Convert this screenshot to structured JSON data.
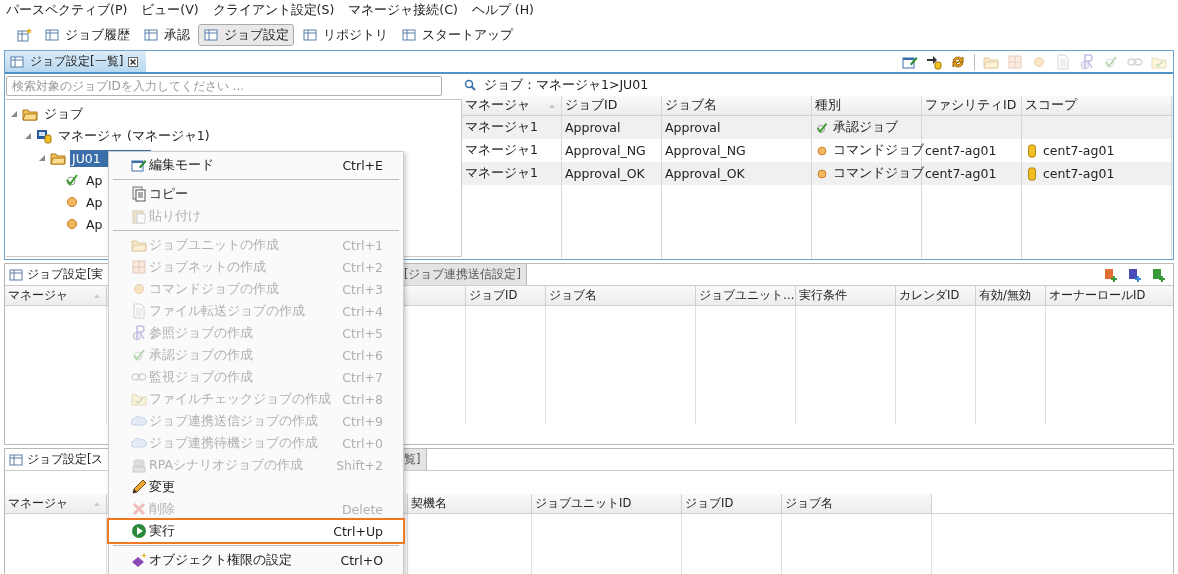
{
  "menu_bar": [
    "パースペクティブ(P)",
    "ビュー(V)",
    "クライアント設定(S)",
    "マネージャ接続(C)",
    "ヘルプ (H)"
  ],
  "perspectives": [
    {
      "label": "ジョブ履歴",
      "selected": false
    },
    {
      "label": "承認",
      "selected": false
    },
    {
      "label": "ジョブ設定",
      "selected": true
    },
    {
      "label": "リポジトリ",
      "selected": false
    },
    {
      "label": "スタートアップ",
      "selected": false
    }
  ],
  "job_list_view": {
    "tab": "ジョブ設定[一覧]",
    "search": {
      "placeholder": "検索対象のジョブIDを入力してください ..."
    },
    "tree": [
      {
        "label": "ジョブ",
        "kind": "root",
        "expanded": true,
        "selected": false,
        "children": [
          {
            "label": "マネージャ (マネージャ1)",
            "kind": "manager",
            "expanded": true,
            "selected": false,
            "children": [
              {
                "label": "JU01",
                "kind": "jobunit",
                "expanded": true,
                "selected": true,
                "children": [
                  {
                    "label": "Ap",
                    "kind": "approval",
                    "selected": false
                  },
                  {
                    "label": "Ap",
                    "kind": "command",
                    "selected": false
                  },
                  {
                    "label": "Ap",
                    "kind": "command",
                    "selected": false
                  }
                ]
              }
            ]
          }
        ]
      }
    ],
    "breadcrumb": "ジョブ：マネージャ1>JU01",
    "table": {
      "columns": [
        "マネージャ",
        "ジョブID",
        "ジョブ名",
        "種別",
        "ファシリティID",
        "スコープ"
      ],
      "rows": [
        {
          "manager": "マネージャ1",
          "job_id": "Approval",
          "job_name": "Approval",
          "kind": "approval",
          "type": "承認ジョブ"
        },
        {
          "manager": "マネージャ1",
          "job_id": "Approval_NG",
          "job_name": "Approval_NG",
          "kind": "command",
          "type": "コマンドジョブ",
          "facility_id": "cent7-ag01",
          "scope": "cent7-ag01"
        },
        {
          "manager": "マネージャ1",
          "job_id": "Approval_OK",
          "job_name": "Approval_OK",
          "kind": "command",
          "type": "コマンドジョブ",
          "facility_id": "cent7-ag01",
          "scope": "cent7-ag01"
        }
      ]
    }
  },
  "trigger_view": {
    "tabs": [
      {
        "label": "ジョブ設定[実",
        "selected": true
      },
      {
        "label": "[ジョブ連携送信設定]",
        "selected": false
      }
    ],
    "columns": [
      "マネージャ",
      "ジョブID",
      "ジョブ名",
      "ジョブユニット…",
      "実行条件",
      "カレンダID",
      "有効/無効",
      "オーナーロールID"
    ]
  },
  "schedule_view": {
    "tabs": [
      {
        "label": "ジョブ設定[ス",
        "selected": true
      },
      {
        "label": "覧]",
        "selected": false
      }
    ],
    "columns": [
      "マネージャ",
      "契機名",
      "ジョブユニットID",
      "ジョブID",
      "ジョブ名"
    ]
  },
  "context_menu": {
    "items": [
      {
        "kind": "item",
        "label": "編集モード",
        "shortcut": "Ctrl+E",
        "disabled": false,
        "highlighted": false
      },
      {
        "kind": "separator"
      },
      {
        "kind": "item",
        "label": "コピー",
        "disabled": false,
        "highlighted": false
      },
      {
        "kind": "item",
        "label": "貼り付け",
        "disabled": true,
        "highlighted": false
      },
      {
        "kind": "separator"
      },
      {
        "kind": "item",
        "label": "ジョブユニットの作成",
        "shortcut": "Ctrl+1",
        "disabled": true,
        "highlighted": false
      },
      {
        "kind": "item",
        "label": "ジョブネットの作成",
        "shortcut": "Ctrl+2",
        "disabled": true,
        "highlighted": false
      },
      {
        "kind": "item",
        "label": "コマンドジョブの作成",
        "shortcut": "Ctrl+3",
        "disabled": true,
        "highlighted": false
      },
      {
        "kind": "item",
        "label": "ファイル転送ジョブの作成",
        "shortcut": "Ctrl+4",
        "disabled": true,
        "highlighted": false
      },
      {
        "kind": "item",
        "label": "参照ジョブの作成",
        "shortcut": "Ctrl+5",
        "disabled": true,
        "highlighted": false
      },
      {
        "kind": "item",
        "label": "承認ジョブの作成",
        "shortcut": "Ctrl+6",
        "disabled": true,
        "highlighted": false
      },
      {
        "kind": "item",
        "label": "監視ジョブの作成",
        "shortcut": "Ctrl+7",
        "disabled": true,
        "highlighted": false
      },
      {
        "kind": "item",
        "label": "ファイルチェックジョブの作成",
        "shortcut": "Ctrl+8",
        "disabled": true,
        "highlighted": false
      },
      {
        "kind": "item",
        "label": "ジョブ連携送信ジョブの作成",
        "shortcut": "Ctrl+9",
        "disabled": true,
        "highlighted": false
      },
      {
        "kind": "item",
        "label": "ジョブ連携待機ジョブの作成",
        "shortcut": "Ctrl+0",
        "disabled": true,
        "highlighted": false
      },
      {
        "kind": "item",
        "label": "RPAシナリオジョブの作成",
        "shortcut": "Shift+2",
        "disabled": true,
        "highlighted": false
      },
      {
        "kind": "item",
        "label": "変更",
        "disabled": false,
        "highlighted": false
      },
      {
        "kind": "item",
        "label": "削除",
        "shortcut": "Delete",
        "disabled": true,
        "highlighted": false
      },
      {
        "kind": "item",
        "label": "実行",
        "shortcut": "Ctrl+Up",
        "disabled": false,
        "highlighted": true
      },
      {
        "kind": "separator"
      },
      {
        "kind": "item",
        "label": "オブジェクト権限の設定",
        "shortcut": "Ctrl+O",
        "disabled": false,
        "highlighted": false
      }
    ]
  }
}
